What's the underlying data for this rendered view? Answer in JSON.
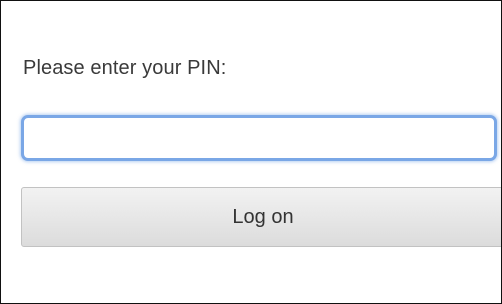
{
  "form": {
    "prompt": "Please enter your PIN:",
    "pin_value": "",
    "pin_placeholder": "",
    "logon_label": "Log on"
  },
  "colors": {
    "focus_ring": "#7aa7e6",
    "button_top": "#f2f2f2",
    "button_bottom": "#dcdcdc",
    "text": "#3a3a3a"
  }
}
